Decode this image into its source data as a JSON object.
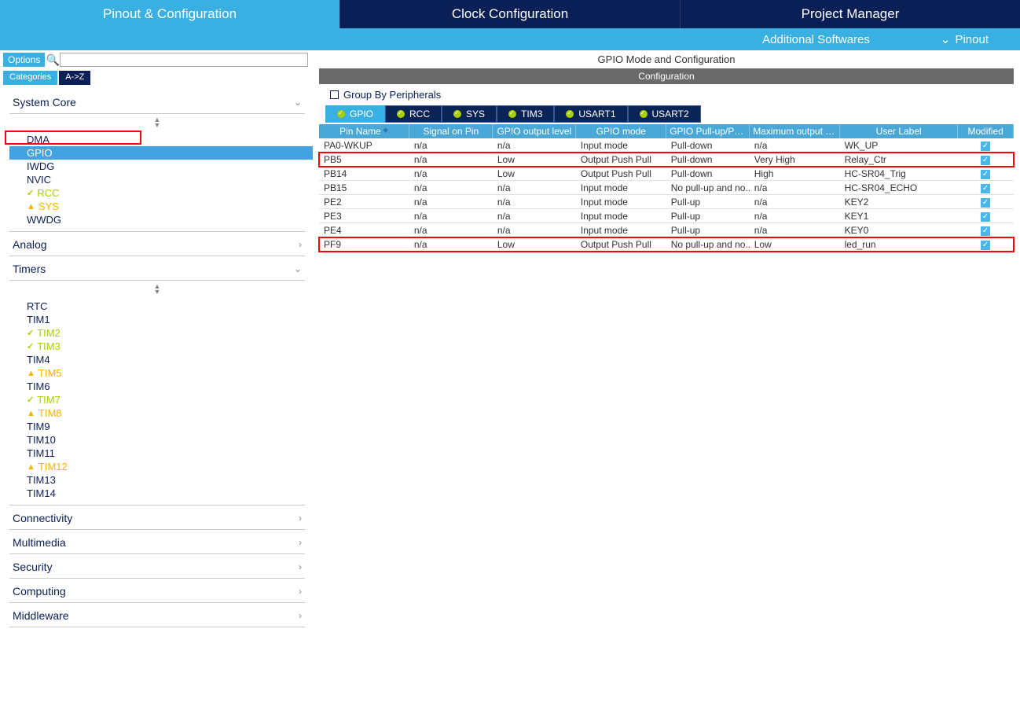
{
  "top_tabs": {
    "pinout": "Pinout & Configuration",
    "clock": "Clock Configuration",
    "project": "Project Manager"
  },
  "sub_bar": {
    "additional": "Additional Softwares",
    "pinout": "Pinout"
  },
  "left": {
    "options": "Options",
    "cat_tab": "Categories",
    "az_tab": "A->Z",
    "sections": {
      "system_core": "System Core",
      "analog": "Analog",
      "timers": "Timers",
      "connectivity": "Connectivity",
      "multimedia": "Multimedia",
      "security": "Security",
      "computing": "Computing",
      "middleware": "Middleware"
    },
    "sys_items": [
      {
        "label": "DMA",
        "status": ""
      },
      {
        "label": "GPIO",
        "status": "",
        "selected": true
      },
      {
        "label": "IWDG",
        "status": ""
      },
      {
        "label": "NVIC",
        "status": ""
      },
      {
        "label": "RCC",
        "status": "ok"
      },
      {
        "label": "SYS",
        "status": "warn"
      },
      {
        "label": "WWDG",
        "status": ""
      }
    ],
    "timer_items": [
      {
        "label": "RTC",
        "status": ""
      },
      {
        "label": "TIM1",
        "status": ""
      },
      {
        "label": "TIM2",
        "status": "ok"
      },
      {
        "label": "TIM3",
        "status": "ok"
      },
      {
        "label": "TIM4",
        "status": ""
      },
      {
        "label": "TIM5",
        "status": "warn"
      },
      {
        "label": "TIM6",
        "status": ""
      },
      {
        "label": "TIM7",
        "status": "ok"
      },
      {
        "label": "TIM8",
        "status": "warn"
      },
      {
        "label": "TIM9",
        "status": ""
      },
      {
        "label": "TIM10",
        "status": ""
      },
      {
        "label": "TIM11",
        "status": ""
      },
      {
        "label": "TIM12",
        "status": "warn"
      },
      {
        "label": "TIM13",
        "status": ""
      },
      {
        "label": "TIM14",
        "status": ""
      }
    ]
  },
  "right": {
    "mode_title": "GPIO Mode and Configuration",
    "cfg_label": "Configuration",
    "group_by": "Group By Peripherals",
    "per_tabs": [
      "GPIO",
      "RCC",
      "SYS",
      "TIM3",
      "USART1",
      "USART2"
    ],
    "columns": [
      "Pin Name",
      "Signal on Pin",
      "GPIO output level",
      "GPIO mode",
      "GPIO Pull-up/Pull-...",
      "Maximum output s...",
      "User Label",
      "Modified"
    ],
    "rows": [
      {
        "pin": "PA0-WKUP",
        "sig": "n/a",
        "out": "n/a",
        "mode": "Input mode",
        "pull": "Pull-down",
        "speed": "n/a",
        "label": "WK_UP",
        "mod": true,
        "hl": false
      },
      {
        "pin": "PB5",
        "sig": "n/a",
        "out": "Low",
        "mode": "Output Push Pull",
        "pull": "Pull-down",
        "speed": "Very High",
        "label": "Relay_Ctr",
        "mod": true,
        "hl": true
      },
      {
        "pin": "PB14",
        "sig": "n/a",
        "out": "Low",
        "mode": "Output Push Pull",
        "pull": "Pull-down",
        "speed": "High",
        "label": "HC-SR04_Trig",
        "mod": true,
        "hl": false
      },
      {
        "pin": "PB15",
        "sig": "n/a",
        "out": "n/a",
        "mode": "Input mode",
        "pull": "No pull-up and no...",
        "speed": "n/a",
        "label": "HC-SR04_ECHO",
        "mod": true,
        "hl": false
      },
      {
        "pin": "PE2",
        "sig": "n/a",
        "out": "n/a",
        "mode": "Input mode",
        "pull": "Pull-up",
        "speed": "n/a",
        "label": "KEY2",
        "mod": true,
        "hl": false
      },
      {
        "pin": "PE3",
        "sig": "n/a",
        "out": "n/a",
        "mode": "Input mode",
        "pull": "Pull-up",
        "speed": "n/a",
        "label": "KEY1",
        "mod": true,
        "hl": false
      },
      {
        "pin": "PE4",
        "sig": "n/a",
        "out": "n/a",
        "mode": "Input mode",
        "pull": "Pull-up",
        "speed": "n/a",
        "label": "KEY0",
        "mod": true,
        "hl": false
      },
      {
        "pin": "PF9",
        "sig": "n/a",
        "out": "Low",
        "mode": "Output Push Pull",
        "pull": "No pull-up and no...",
        "speed": "Low",
        "label": "led_run",
        "mod": true,
        "hl": true
      }
    ]
  }
}
